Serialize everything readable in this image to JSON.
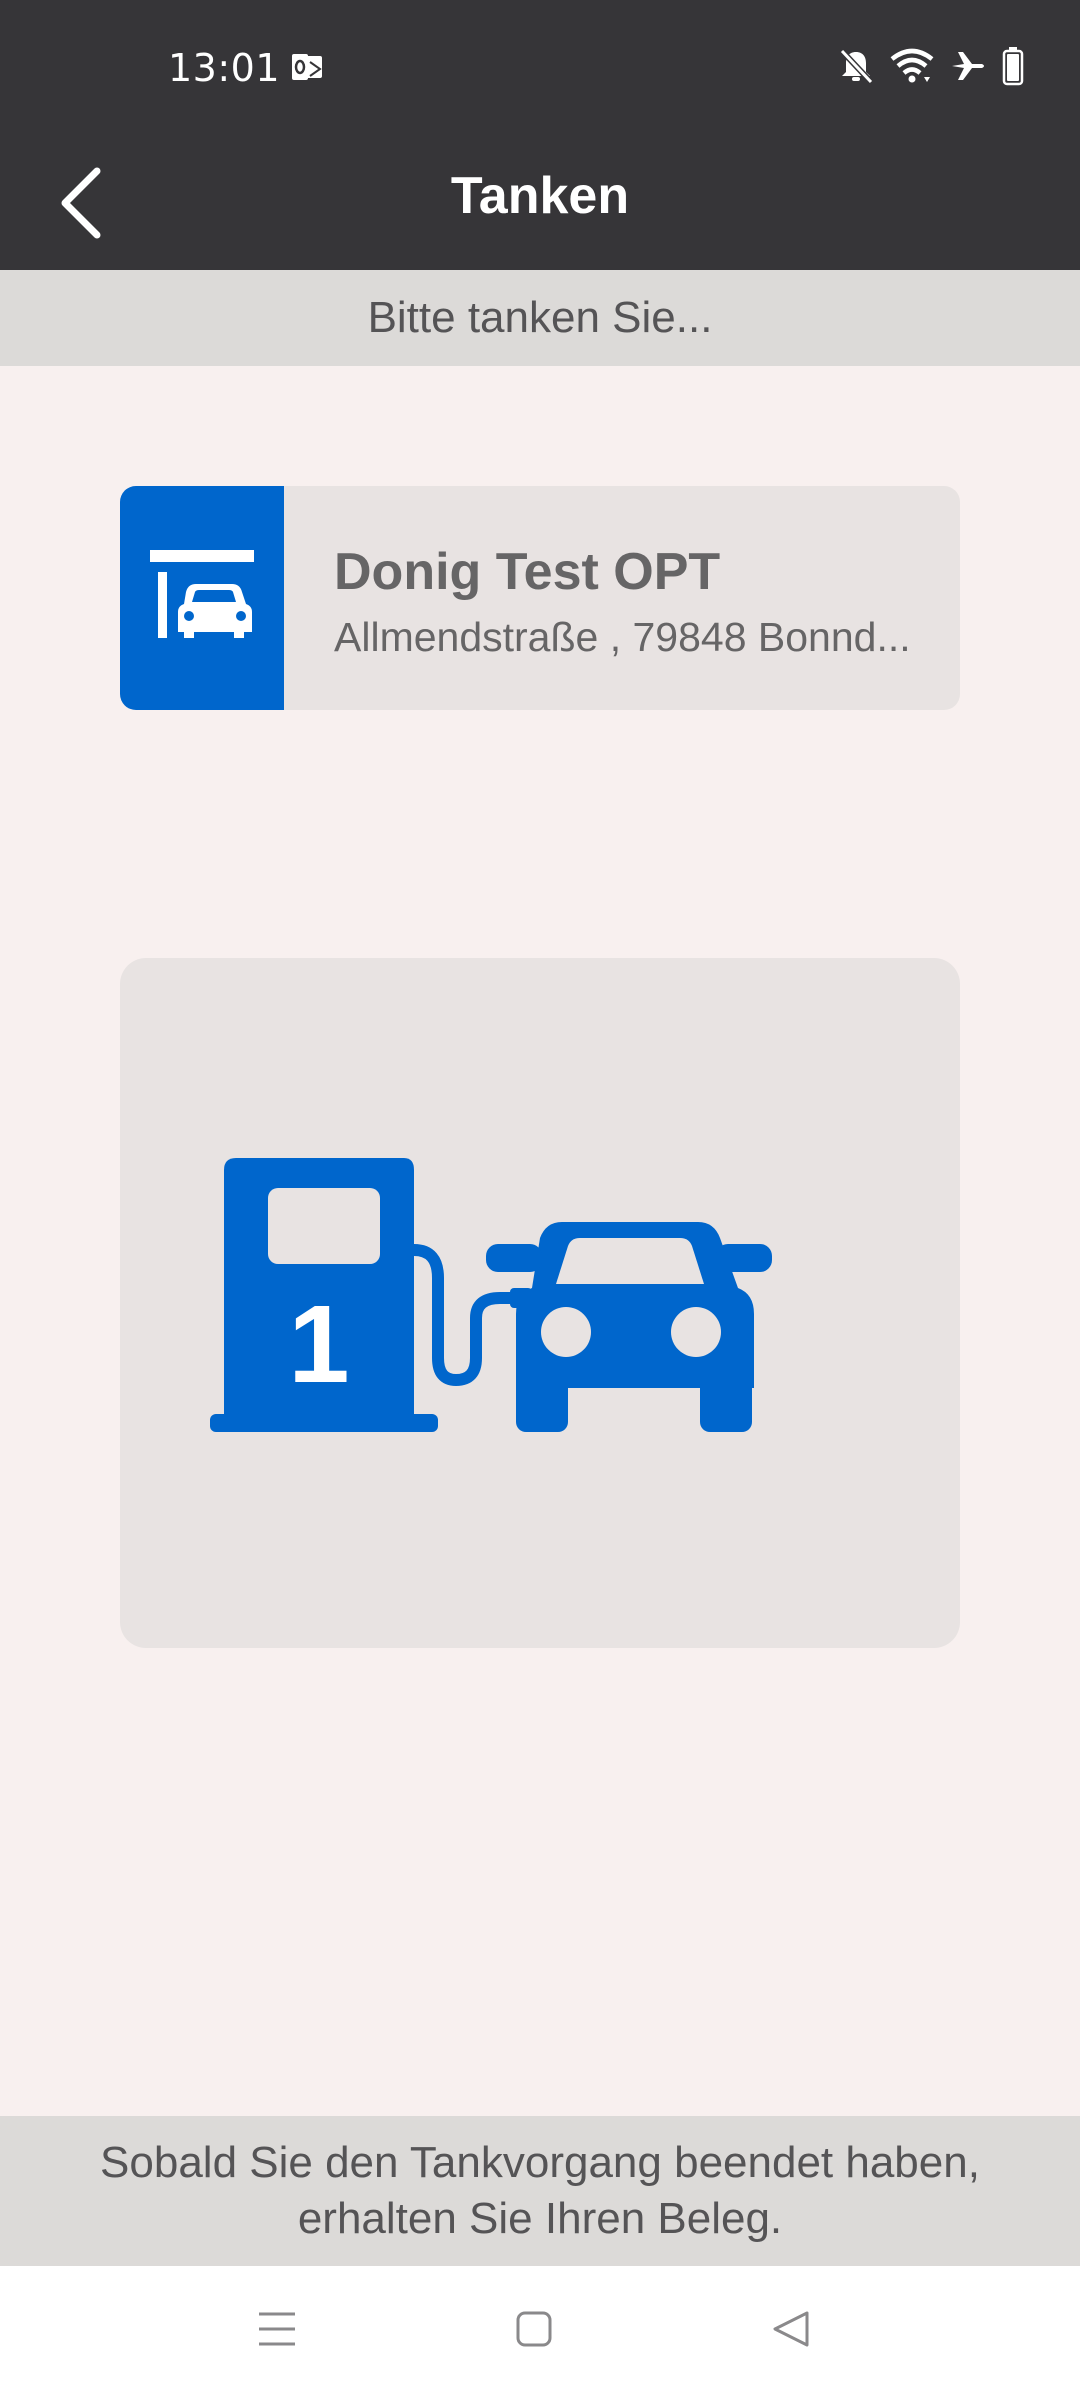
{
  "status_bar": {
    "time": "13:01",
    "icons": [
      "outlook-notification-icon",
      "bell-off-icon",
      "wifi-icon",
      "airplane-icon",
      "battery-icon"
    ]
  },
  "app_bar": {
    "title": "Tanken",
    "back_icon": "chevron-left-icon"
  },
  "sub_header": {
    "text": "Bitte tanken Sie..."
  },
  "station": {
    "name": "Donig Test OPT",
    "address": "Allmendstraße , 79848 Bonnd...",
    "icon": "gas-station-car-icon"
  },
  "pump": {
    "number": "1",
    "icon": "fuel-pump-car-icon"
  },
  "footer": {
    "line1": "Sobald Sie den Tankvorgang beendet haben,",
    "line2": "erhalten Sie Ihren Beleg."
  },
  "nav_bar": {
    "items": [
      "menu-icon",
      "home-icon",
      "back-icon"
    ]
  },
  "colors": {
    "accent_blue": "#0066cc",
    "app_bar_bg": "#363538",
    "page_bg": "#f8f0ef",
    "card_bg": "#e8e3e2",
    "banner_bg": "#dcdad8"
  }
}
